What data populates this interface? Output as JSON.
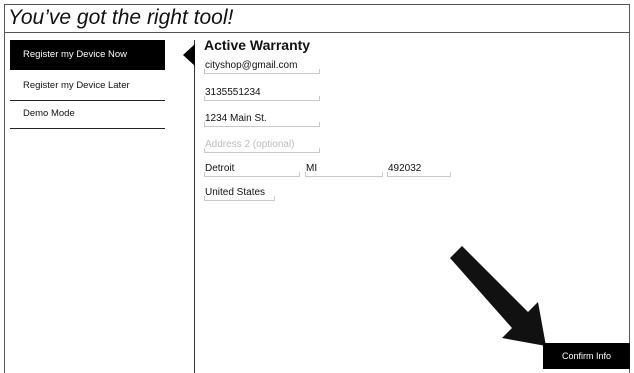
{
  "headline": "You’ve got the right tool!",
  "sidebar": {
    "items": [
      {
        "label": "Register my Device Now",
        "active": true
      },
      {
        "label": "Register my Device Later",
        "active": false
      },
      {
        "label": "Demo Mode",
        "active": false
      }
    ]
  },
  "main": {
    "title": "Active Warranty",
    "fields": {
      "email": "cityshop@gmail.com",
      "phone": "3135551234",
      "address1": "1234 Main St.",
      "address2_placeholder": "Address 2 (optional)",
      "city": "Detroit",
      "state": "MI",
      "zip": "492032",
      "country": "United States"
    }
  },
  "actions": {
    "confirm_label": "Confirm Info"
  },
  "icons": {
    "pointer": "arrow-pointer-icon"
  },
  "colors": {
    "active_bg": "#000000",
    "button_bg": "#000000",
    "field_line": "#c8c8c8"
  }
}
